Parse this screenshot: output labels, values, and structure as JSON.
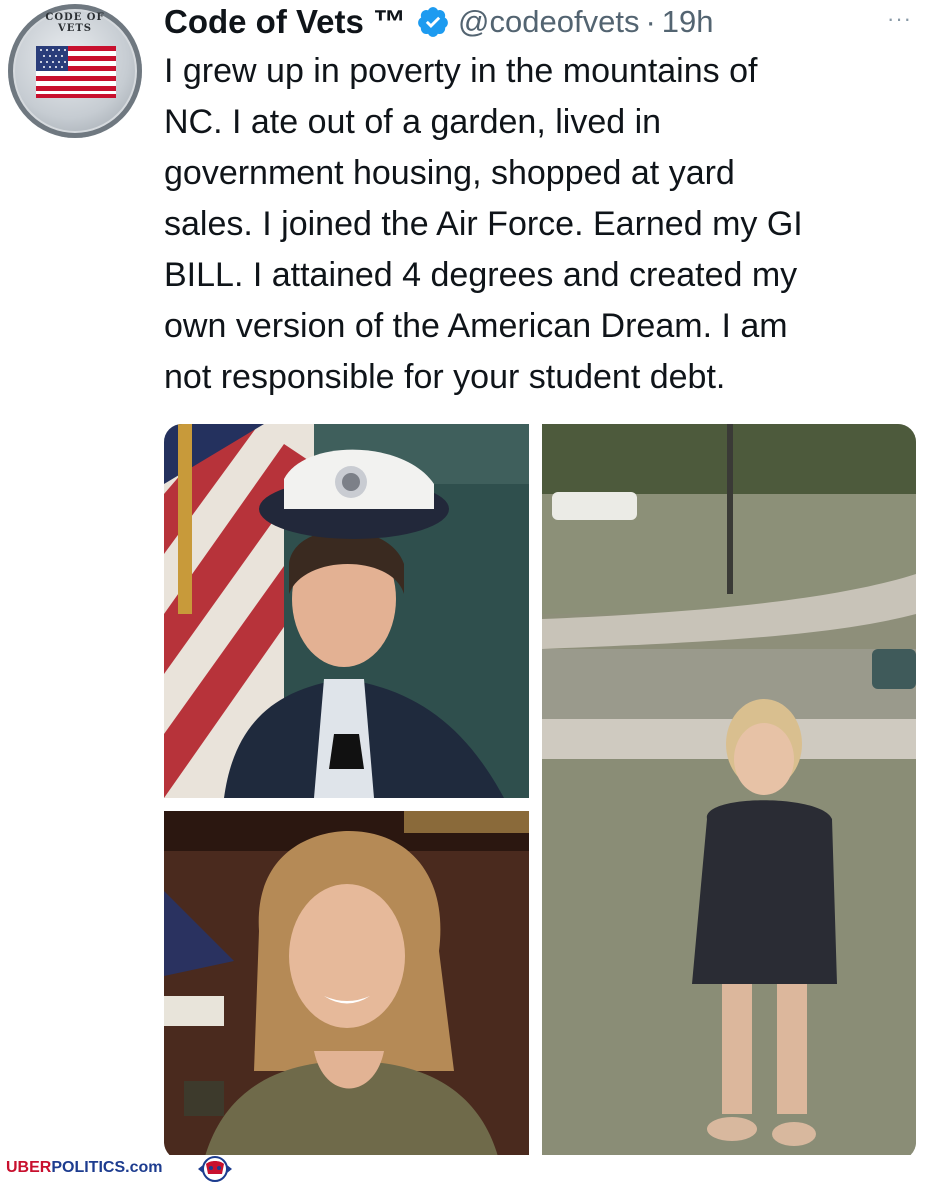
{
  "avatar": {
    "ring_text": "CODE OF VETS"
  },
  "tweet": {
    "display_name": "Code of Vets ™",
    "verified_icon": "verified-badge-icon",
    "handle": "@codeofvets",
    "separator": "·",
    "time": "19h",
    "more_icon": "more-options-icon",
    "more_label": "···",
    "text_lines": [
      "I grew up in poverty in the mountains of",
      "NC. I ate out of a garden, lived in",
      "government housing, shopped at yard",
      "sales. I joined the Air Force. Earned my GI",
      "BILL. I attained 4 degrees and created my",
      "own version of the American Dream. I am",
      "not responsible for your student debt."
    ]
  },
  "media": {
    "photos": [
      {
        "name": "air-force-portrait-photo"
      },
      {
        "name": "adult-portrait-photo"
      },
      {
        "name": "childhood-photo"
      }
    ]
  },
  "watermark": {
    "uber": "UBER",
    "politics": "POLITICS",
    "com": ".com",
    "logo_icon": "uberpolitics-logo-icon"
  },
  "colors": {
    "verified": "#1d9bf0",
    "handle": "#536471",
    "watermark_red": "#c8102e",
    "watermark_blue": "#1d3c8f"
  }
}
